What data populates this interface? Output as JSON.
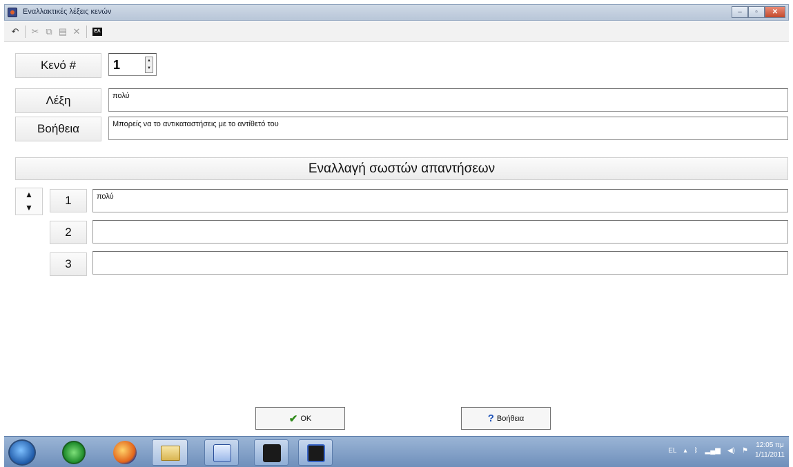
{
  "window": {
    "title": "Εναλλακτικές λέξεις κενών",
    "controls": {
      "minimize": "–",
      "maximize": "▫",
      "close": "✕"
    }
  },
  "toolbar": {
    "icons": [
      "undo-icon",
      "cut-icon",
      "copy-icon",
      "paste-icon",
      "delete-icon",
      "greek-keyboard-icon"
    ],
    "greek_badge": "ΕΛ"
  },
  "form": {
    "gap_label": "Κενό #",
    "gap_number": "1",
    "word_label": "Λέξη",
    "word_value": "πολύ",
    "help_label": "Βοήθεια",
    "help_value": "Μπορείς να το αντικαταστήσεις με το αντίθετό του"
  },
  "alternatives": {
    "header": "Εναλλαγή σωστών απαντήσεων",
    "rows": [
      {
        "number": "1",
        "value": "πολύ"
      },
      {
        "number": "2",
        "value": ""
      },
      {
        "number": "3",
        "value": ""
      }
    ]
  },
  "buttons": {
    "ok_label": "OK",
    "help_label": "Βοήθεια"
  },
  "taskbar": {
    "language": "EL",
    "time": "12:05 πμ",
    "date": "1/11/2011"
  }
}
